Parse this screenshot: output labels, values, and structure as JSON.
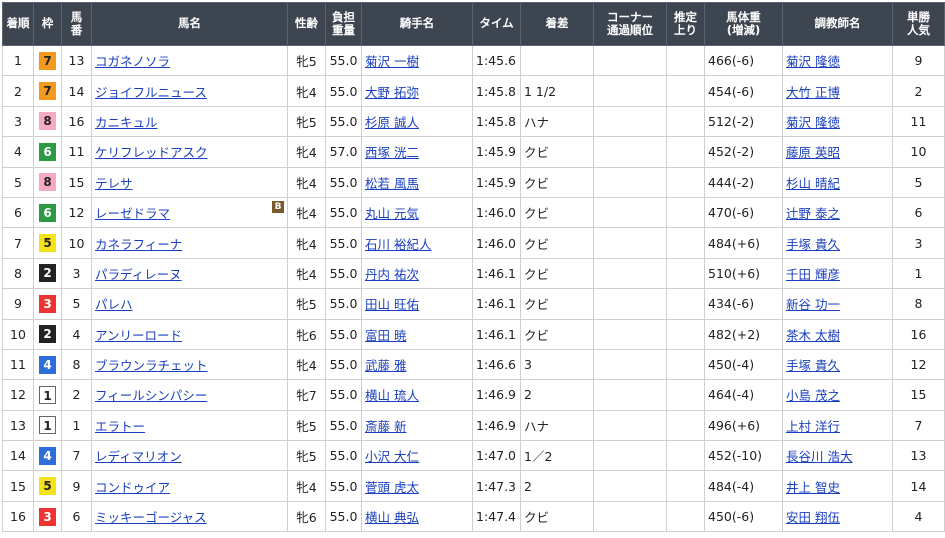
{
  "headers": [
    "着順",
    "枠",
    "馬番",
    "馬名",
    "性齢",
    "負担重量",
    "騎手名",
    "タイム",
    "着差",
    "コーナー通過順位",
    "推定上り",
    "馬体重(増減)",
    "調教師名",
    "単勝人気"
  ],
  "rows": [
    {
      "rank": "1",
      "waku": "7",
      "num": "13",
      "horse": "コガネノソラ",
      "sex": "牝5",
      "weight": "55.0",
      "jockey": "菊沢 一樹",
      "time": "1:45.6",
      "margin": "",
      "corner": "",
      "agari": "",
      "bw": "466(-6)",
      "trainer": "菊沢 隆徳",
      "pop": "9",
      "blinker": ""
    },
    {
      "rank": "2",
      "waku": "7",
      "num": "14",
      "horse": "ジョイフルニュース",
      "sex": "牝4",
      "weight": "55.0",
      "jockey": "大野 拓弥",
      "time": "1:45.8",
      "margin": "1 1/2",
      "corner": "",
      "agari": "",
      "bw": "454(-6)",
      "trainer": "大竹 正博",
      "pop": "2",
      "blinker": ""
    },
    {
      "rank": "3",
      "waku": "8",
      "num": "16",
      "horse": "カニキュル",
      "sex": "牝5",
      "weight": "55.0",
      "jockey": "杉原 誠人",
      "time": "1:45.8",
      "margin": "ハナ",
      "corner": "",
      "agari": "",
      "bw": "512(-2)",
      "trainer": "菊沢 隆徳",
      "pop": "11",
      "blinker": ""
    },
    {
      "rank": "4",
      "waku": "6",
      "num": "11",
      "horse": "ケリフレッドアスク",
      "sex": "牝4",
      "weight": "57.0",
      "jockey": "西塚 洸二",
      "time": "1:45.9",
      "margin": "クビ",
      "corner": "",
      "agari": "",
      "bw": "452(-2)",
      "trainer": "藤原 英昭",
      "pop": "10",
      "blinker": ""
    },
    {
      "rank": "5",
      "waku": "8",
      "num": "15",
      "horse": "テレサ",
      "sex": "牝4",
      "weight": "55.0",
      "jockey": "松若 風馬",
      "time": "1:45.9",
      "margin": "クビ",
      "corner": "",
      "agari": "",
      "bw": "444(-2)",
      "trainer": "杉山 晴紀",
      "pop": "5",
      "blinker": ""
    },
    {
      "rank": "6",
      "waku": "6",
      "num": "12",
      "horse": "レーゼドラマ",
      "sex": "牝4",
      "weight": "55.0",
      "jockey": "丸山 元気",
      "time": "1:46.0",
      "margin": "クビ",
      "corner": "",
      "agari": "",
      "bw": "470(-6)",
      "trainer": "辻野 泰之",
      "pop": "6",
      "blinker": "B"
    },
    {
      "rank": "7",
      "waku": "5",
      "num": "10",
      "horse": "カネラフィーナ",
      "sex": "牝4",
      "weight": "55.0",
      "jockey": "石川 裕紀人",
      "time": "1:46.0",
      "margin": "クビ",
      "corner": "",
      "agari": "",
      "bw": "484(+6)",
      "trainer": "手塚 貴久",
      "pop": "3",
      "blinker": ""
    },
    {
      "rank": "8",
      "waku": "2",
      "num": "3",
      "horse": "パラディレーヌ",
      "sex": "牝4",
      "weight": "55.0",
      "jockey": "丹内 祐次",
      "time": "1:46.1",
      "margin": "クビ",
      "corner": "",
      "agari": "",
      "bw": "510(+6)",
      "trainer": "千田 輝彦",
      "pop": "1",
      "blinker": ""
    },
    {
      "rank": "9",
      "waku": "3",
      "num": "5",
      "horse": "パレハ",
      "sex": "牝5",
      "weight": "55.0",
      "jockey": "田山 旺佑",
      "time": "1:46.1",
      "margin": "クビ",
      "corner": "",
      "agari": "",
      "bw": "434(-6)",
      "trainer": "新谷 功一",
      "pop": "8",
      "blinker": ""
    },
    {
      "rank": "10",
      "waku": "2",
      "num": "4",
      "horse": "アンリーロード",
      "sex": "牝6",
      "weight": "55.0",
      "jockey": "富田 暁",
      "time": "1:46.1",
      "margin": "クビ",
      "corner": "",
      "agari": "",
      "bw": "482(+2)",
      "trainer": "茶木 太樹",
      "pop": "16",
      "blinker": ""
    },
    {
      "rank": "11",
      "waku": "4",
      "num": "8",
      "horse": "ブラウンラチェット",
      "sex": "牝4",
      "weight": "55.0",
      "jockey": "武藤 雅",
      "time": "1:46.6",
      "margin": "3",
      "corner": "",
      "agari": "",
      "bw": "450(-4)",
      "trainer": "手塚 貴久",
      "pop": "12",
      "blinker": ""
    },
    {
      "rank": "12",
      "waku": "1",
      "num": "2",
      "horse": "フィールシンパシー",
      "sex": "牝7",
      "weight": "55.0",
      "jockey": "横山 琉人",
      "time": "1:46.9",
      "margin": "2",
      "corner": "",
      "agari": "",
      "bw": "464(-4)",
      "trainer": "小島 茂之",
      "pop": "15",
      "blinker": ""
    },
    {
      "rank": "13",
      "waku": "1",
      "num": "1",
      "horse": "エラトー",
      "sex": "牝5",
      "weight": "55.0",
      "jockey": "斎藤 新",
      "time": "1:46.9",
      "margin": "ハナ",
      "corner": "",
      "agari": "",
      "bw": "496(+6)",
      "trainer": "上村 洋行",
      "pop": "7",
      "blinker": ""
    },
    {
      "rank": "14",
      "waku": "4",
      "num": "7",
      "horse": "レディマリオン",
      "sex": "牝5",
      "weight": "55.0",
      "jockey": "小沢 大仁",
      "time": "1:47.0",
      "margin": "1／2",
      "corner": "",
      "agari": "",
      "bw": "452(-10)",
      "trainer": "長谷川 浩大",
      "pop": "13",
      "blinker": ""
    },
    {
      "rank": "15",
      "waku": "5",
      "num": "9",
      "horse": "コンドゥイア",
      "sex": "牝4",
      "weight": "55.0",
      "jockey": "菅頭 虎太",
      "time": "1:47.3",
      "margin": "2",
      "corner": "",
      "agari": "",
      "bw": "484(-4)",
      "trainer": "井上 智史",
      "pop": "14",
      "blinker": ""
    },
    {
      "rank": "16",
      "waku": "3",
      "num": "6",
      "horse": "ミッキーゴージャス",
      "sex": "牝6",
      "weight": "55.0",
      "jockey": "横山 典弘",
      "time": "1:47.4",
      "margin": "クビ",
      "corner": "",
      "agari": "",
      "bw": "450(-6)",
      "trainer": "安田 翔伍",
      "pop": "4",
      "blinker": ""
    }
  ]
}
